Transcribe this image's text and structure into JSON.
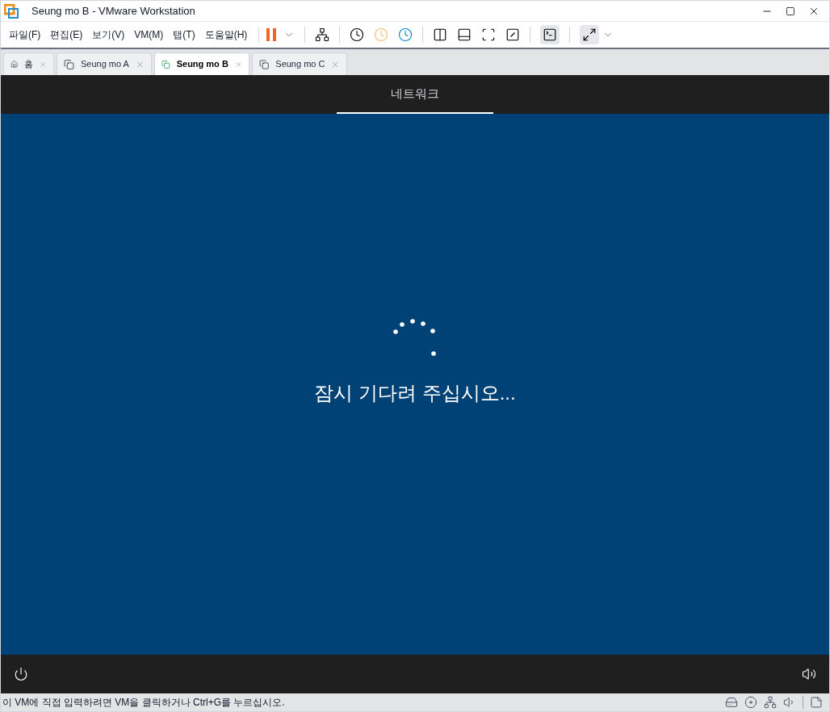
{
  "window": {
    "title": "Seung mo B - VMware Workstation"
  },
  "menu": [
    "파일(F)",
    "편집(E)",
    "보기(V)",
    "VM(M)",
    "탭(T)",
    "도움말(H)"
  ],
  "tabs": [
    {
      "kind": "home",
      "label": "홈",
      "selected": false
    },
    {
      "kind": "vm",
      "label": "Seung mo A",
      "selected": false
    },
    {
      "kind": "vm",
      "label": "Seung mo B",
      "selected": true
    },
    {
      "kind": "vm",
      "label": "Seung mo C",
      "selected": false
    }
  ],
  "guest": {
    "header_tab": "네트워크",
    "message": "잠시 기다려 주십시오..."
  },
  "status_bar": {
    "text": "이 VM에 직접 입력하려면 VM을 클릭하거나 Ctrl+G를 누르십시오."
  }
}
